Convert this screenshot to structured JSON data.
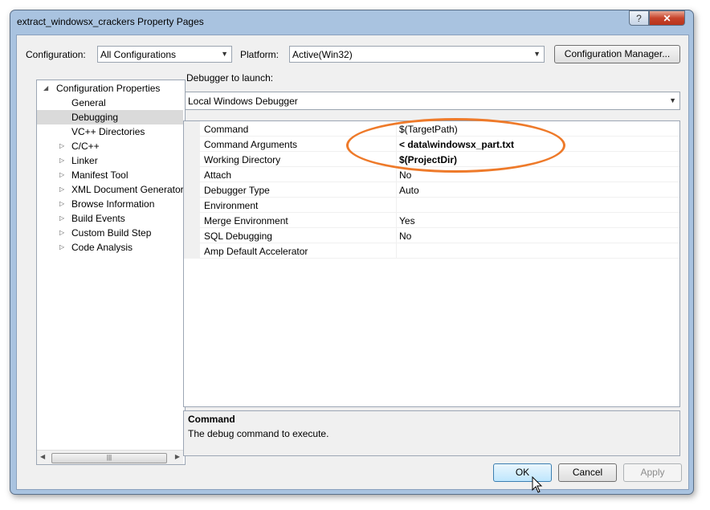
{
  "window": {
    "title": "extract_windowsx_crackers Property Pages",
    "help_label": "?",
    "close_label": "✕"
  },
  "config": {
    "configuration_label": "Configuration:",
    "configuration_value": "All Configurations",
    "platform_label": "Platform:",
    "platform_value": "Active(Win32)",
    "manager_button": "Configuration Manager..."
  },
  "tree": {
    "root": "Configuration Properties",
    "items": [
      {
        "label": "General"
      },
      {
        "label": "Debugging",
        "selected": true
      },
      {
        "label": "VC++ Directories"
      },
      {
        "label": "C/C++",
        "expandable": true
      },
      {
        "label": "Linker",
        "expandable": true
      },
      {
        "label": "Manifest Tool",
        "expandable": true
      },
      {
        "label": "XML Document Generator",
        "expandable": true
      },
      {
        "label": "Browse Information",
        "expandable": true
      },
      {
        "label": "Build Events",
        "expandable": true
      },
      {
        "label": "Custom Build Step",
        "expandable": true
      },
      {
        "label": "Code Analysis",
        "expandable": true
      }
    ],
    "scroll_thumb": "|||"
  },
  "debugger": {
    "launch_label": "Debugger to launch:",
    "launch_value": "Local Windows Debugger"
  },
  "properties": [
    {
      "name": "Command",
      "value": "$(TargetPath)",
      "bold": false
    },
    {
      "name": "Command Arguments",
      "value": "< data\\windowsx_part.txt",
      "bold": true
    },
    {
      "name": "Working Directory",
      "value": "$(ProjectDir)",
      "bold": true
    },
    {
      "name": "Attach",
      "value": "No",
      "bold": false
    },
    {
      "name": "Debugger Type",
      "value": "Auto",
      "bold": false
    },
    {
      "name": "Environment",
      "value": "",
      "bold": false
    },
    {
      "name": "Merge Environment",
      "value": "Yes",
      "bold": false
    },
    {
      "name": "SQL Debugging",
      "value": "No",
      "bold": false
    },
    {
      "name": "Amp Default Accelerator",
      "value": "",
      "bold": false
    }
  ],
  "description": {
    "title": "Command",
    "text": "The debug command to execute."
  },
  "buttons": {
    "ok": "OK",
    "cancel": "Cancel",
    "apply": "Apply"
  },
  "colors": {
    "highlight_oval": "#ee7a2a",
    "title_bar": "#a9c3e0",
    "ok_button_border": "#3c7fb1"
  }
}
